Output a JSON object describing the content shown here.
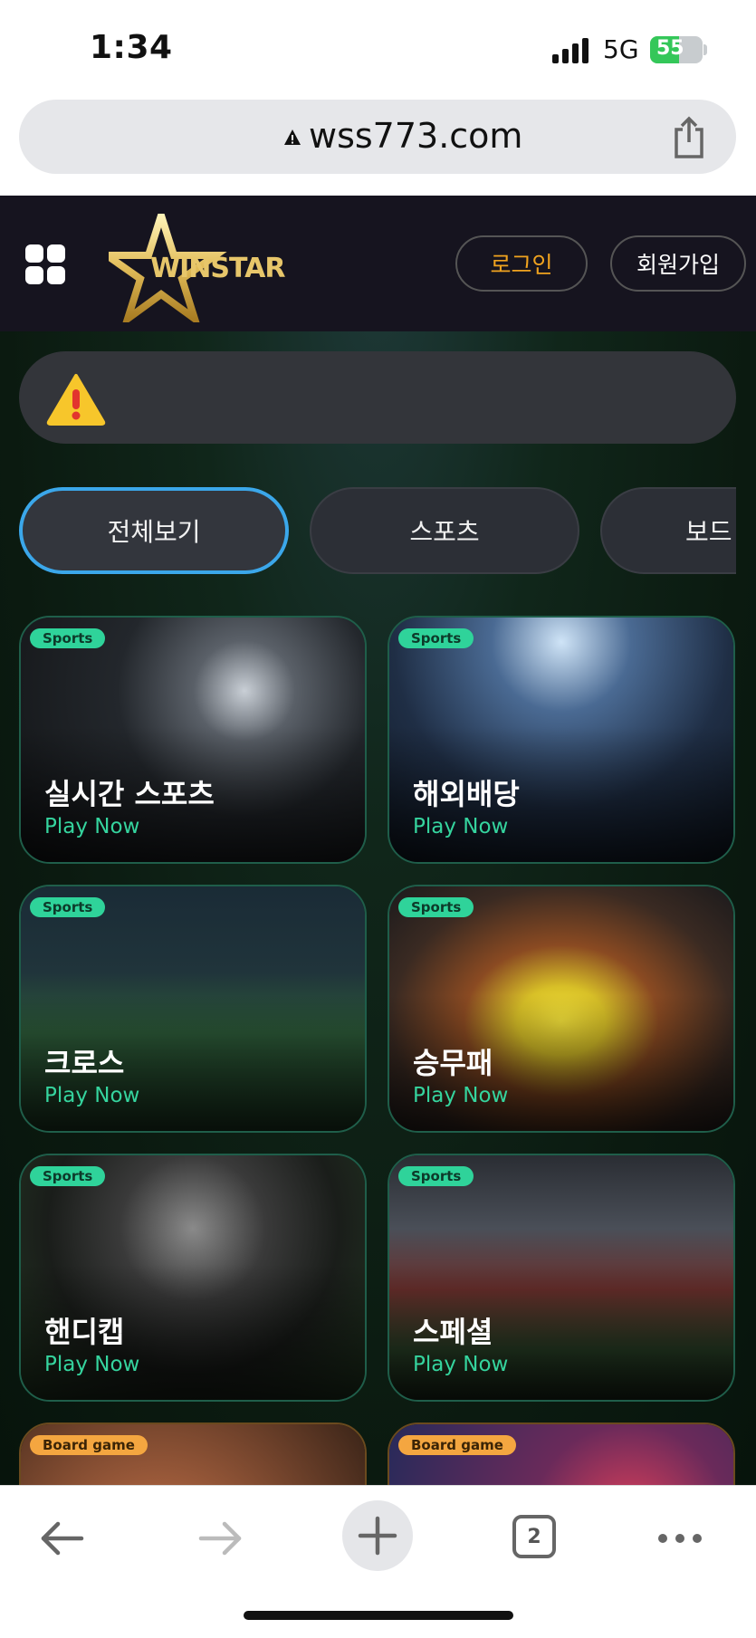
{
  "status_bar": {
    "time": "1:34",
    "network": "5G",
    "battery": "55",
    "battery_level": 0.55
  },
  "browser": {
    "url": "wss773.com",
    "icons": [
      "warning-lock-icon",
      "share-icon"
    ]
  },
  "site": {
    "logo_text": "WINSTAR",
    "login_label": "로그인",
    "join_label": "회원가입",
    "colors": {
      "accent_gold": "#e7c66a",
      "login_orange": "#f0a31f",
      "badge_green": "#2fd39a",
      "active_tab_border": "#3ba7ea"
    }
  },
  "tabs": [
    {
      "label": "전체보기",
      "active": true
    },
    {
      "label": "스포츠",
      "active": false
    },
    {
      "label": "보드",
      "active": false
    }
  ],
  "cards": [
    {
      "badge": "Sports",
      "title": "실시간 스포츠",
      "cta": "Play Now"
    },
    {
      "badge": "Sports",
      "title": "해외배당",
      "cta": "Play Now"
    },
    {
      "badge": "Sports",
      "title": "크로스",
      "cta": "Play Now"
    },
    {
      "badge": "Sports",
      "title": "승무패",
      "cta": "Play Now"
    },
    {
      "badge": "Sports",
      "title": "핸디캡",
      "cta": "Play Now"
    },
    {
      "badge": "Sports",
      "title": "스페셜",
      "cta": "Play Now"
    },
    {
      "badge": "Board game",
      "title": "",
      "cta": ""
    },
    {
      "badge": "Board game",
      "title": "",
      "cta": ""
    }
  ],
  "toolbar": {
    "tab_count": "2"
  }
}
